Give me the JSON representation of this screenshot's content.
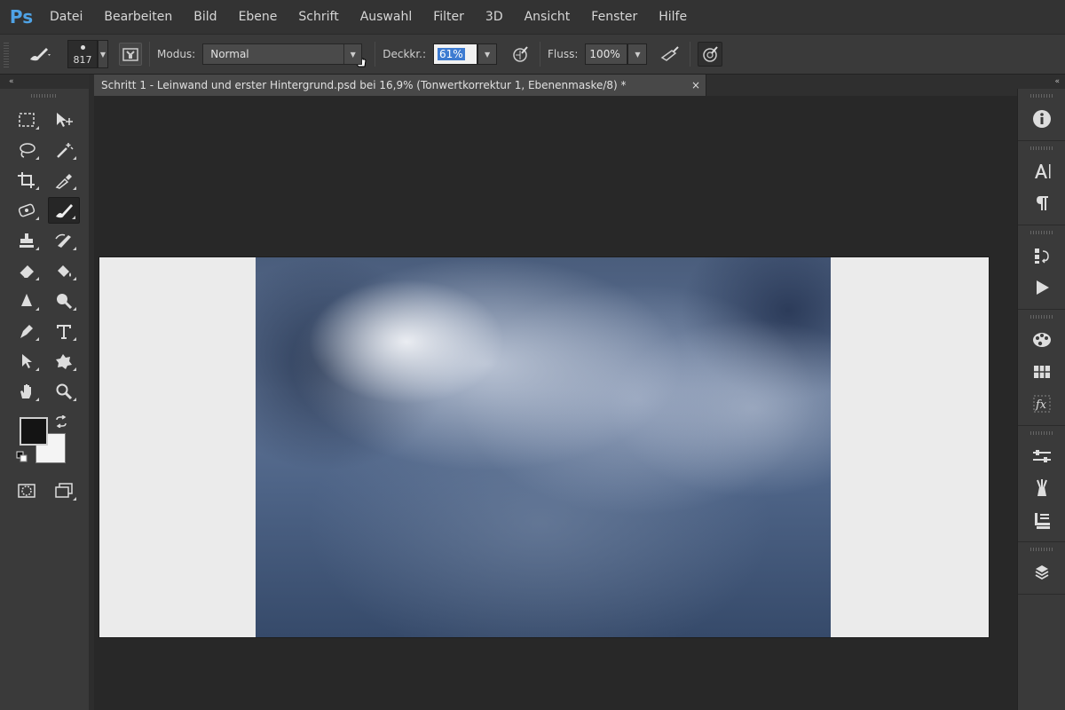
{
  "app": {
    "logo": "Ps",
    "accent": "#4fa3e6"
  },
  "menu": [
    "Datei",
    "Bearbeiten",
    "Bild",
    "Ebene",
    "Schrift",
    "Auswahl",
    "Filter",
    "3D",
    "Ansicht",
    "Fenster",
    "Hilfe"
  ],
  "options": {
    "brush_size": "817",
    "mode_label": "Modus:",
    "mode_value": "Normal",
    "opacity_label": "Deckkr.:",
    "opacity_value": "61%",
    "flow_label": "Fluss:",
    "flow_value": "100%"
  },
  "collapse_glyph": "«",
  "document": {
    "tab_title": "Schritt 1 - Leinwand und erster Hintergrund.psd bei 16,9% (Tonwertkorrektur 1, Ebenenmaske/8) *",
    "close_glyph": "×"
  },
  "tools": [
    [
      "marquee-icon",
      "move-icon"
    ],
    [
      "lasso-icon",
      "magic-wand-icon"
    ],
    [
      "crop-icon",
      "eyedropper-icon"
    ],
    [
      "healing-brush-icon",
      "brush-icon"
    ],
    [
      "stamp-icon",
      "history-brush-icon"
    ],
    [
      "eraser-icon",
      "paint-bucket-icon"
    ],
    [
      "blur-icon",
      "dodge-icon"
    ],
    [
      "pen-icon",
      "type-icon"
    ],
    [
      "path-select-icon",
      "shape-icon"
    ],
    [
      "hand-icon",
      "zoom-icon"
    ]
  ],
  "colors": {
    "foreground": "#141414",
    "background": "#f4f4f4"
  },
  "right_dock": [
    "info-icon",
    "character-icon",
    "paragraph-icon",
    "history-icon",
    "actions-icon",
    "color-icon",
    "swatches-icon",
    "styles-icon",
    "adjustments-icon",
    "brush-presets-icon",
    "clone-source-icon",
    "layers-icon"
  ]
}
